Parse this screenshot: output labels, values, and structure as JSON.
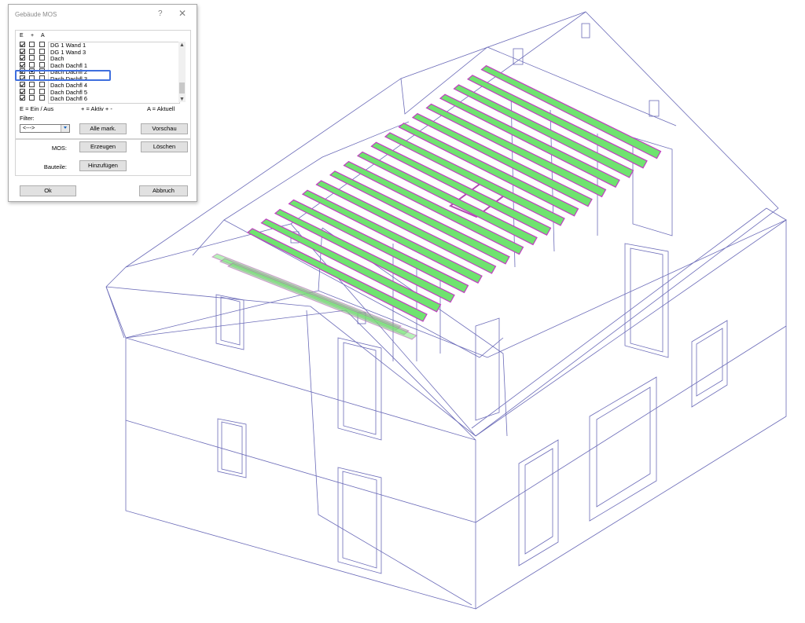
{
  "dialog": {
    "title": "Gebäude MOS",
    "help_glyph": "?",
    "close_glyph": "✕",
    "list_headers": {
      "e": "E",
      "plus": "+",
      "a": "A"
    },
    "layers": [
      {
        "label": "DG 1 Wand 1",
        "e": true,
        "active": false,
        "current": false
      },
      {
        "label": "DG 1 Wand 3",
        "e": true,
        "active": false,
        "current": false
      },
      {
        "label": "Dach",
        "e": true,
        "active": false,
        "current": false
      },
      {
        "label": "Dach Dachfl 1",
        "e": true,
        "active": false,
        "current": false
      },
      {
        "label": "Dach Dachfl 2",
        "e": true,
        "active": true,
        "current": false,
        "highlighted": true
      },
      {
        "label": "Dach Dachfl 3",
        "e": true,
        "active": false,
        "current": false
      },
      {
        "label": "Dach Dachfl 4",
        "e": true,
        "active": false,
        "current": false
      },
      {
        "label": "Dach Dachfl 5",
        "e": true,
        "active": false,
        "current": false
      },
      {
        "label": "Dach Dachfl 6",
        "e": true,
        "active": false,
        "current": false
      }
    ],
    "legend": {
      "e": "E = Ein / Aus",
      "plus": "+ = Aktiv + -",
      "a": "A = Aktuell"
    },
    "filter_label": "Filter:",
    "filter_value": "<--->",
    "alle_mark_label": "Alle mark.",
    "vorschau_label": "Vorschau",
    "mos_label": "MOS:",
    "erzeugen_label": "Erzeugen",
    "loeschen_label": "Löschen",
    "bauteile_label": "Bauteile:",
    "hinzufuegen_label": "Hinzufügen",
    "ok_label": "Ok",
    "abbruch_label": "Abbruch"
  },
  "scene": {
    "description_icon": "house-wireframe-3d",
    "wire_color": "#6b6bb8",
    "rafter_fill": "#6fe36f",
    "rafter_edge": "#c23dc2",
    "rafter_count": 18
  }
}
